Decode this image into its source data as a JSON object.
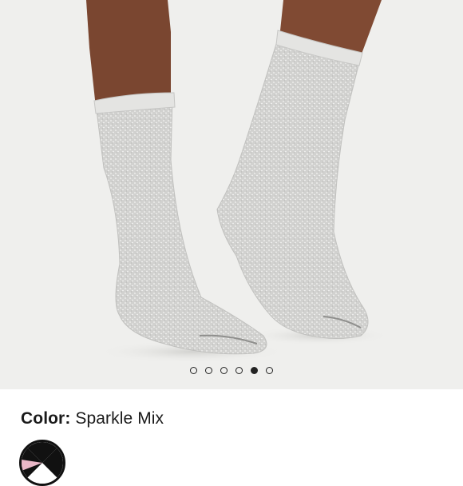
{
  "product": {
    "color_label": "Color:",
    "color_value": "Sparkle Mix",
    "color_swatch_icon": "sparkle-mix-swatch-icon"
  },
  "gallery": {
    "image": "product-photo-sparkle-crew-socks",
    "slide_count": 6,
    "active_slide": 5
  },
  "colors": {
    "gallery_bg": "#efefed",
    "sock": "#d2d2d0",
    "skin": "#7a4630",
    "dot_active": "#222222"
  }
}
